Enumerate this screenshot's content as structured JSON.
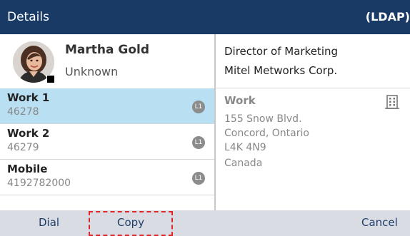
{
  "header": {
    "title": "Details",
    "source": "(LDAP)"
  },
  "contact": {
    "name": "Martha Gold",
    "status": "Unknown"
  },
  "numbers": [
    {
      "label": "Work 1",
      "value": "46278",
      "line": "L1",
      "selected": true
    },
    {
      "label": "Work 2",
      "value": "46279",
      "line": "L1",
      "selected": false
    },
    {
      "label": "Mobile",
      "value": "4192782000",
      "line": "L1",
      "selected": false
    }
  ],
  "details": {
    "job_title": "Director of Marketing",
    "company": "Mitel Metworks Corp.",
    "address_type": "Work",
    "address_lines": [
      "155 Snow Blvd.",
      "Concord, Ontario",
      "L4K 4N9",
      "Canada"
    ]
  },
  "softkeys": {
    "dial": "Dial",
    "copy": "Copy",
    "cancel": "Cancel"
  },
  "colors": {
    "header_bg": "#1a3a66",
    "selected_row": "#b8dff2",
    "softkey_bar": "#d9dde3",
    "highlight": "#e0262a"
  },
  "icons": {
    "avatar": "contact-photo",
    "presence": "presence-indicator",
    "line_badge": "line-badge-icon",
    "address": "building-icon"
  }
}
